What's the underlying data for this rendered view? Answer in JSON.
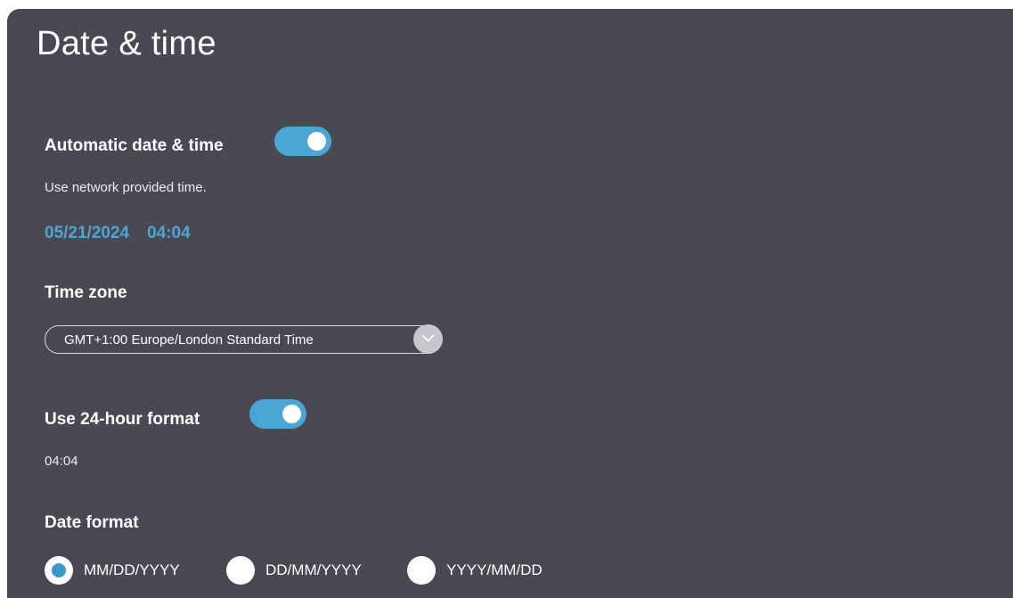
{
  "page": {
    "title": "Date & time"
  },
  "auto_datetime": {
    "label": "Automatic date & time",
    "enabled": true,
    "description": "Use network provided time.",
    "date": "05/21/2024",
    "time": "04:04"
  },
  "timezone": {
    "label": "Time zone",
    "value": "GMT+1:00 Europe/London Standard Time"
  },
  "hour24": {
    "label": "Use 24-hour format",
    "enabled": true,
    "preview": "04:04"
  },
  "date_format": {
    "label": "Date format",
    "options": [
      {
        "label": "MM/DD/YYYY",
        "selected": true
      },
      {
        "label": "DD/MM/YYYY",
        "selected": false
      },
      {
        "label": "YYYY/MM/DD",
        "selected": false
      }
    ]
  },
  "colors": {
    "background": "#4a4852",
    "accent": "#4aa6d2"
  }
}
